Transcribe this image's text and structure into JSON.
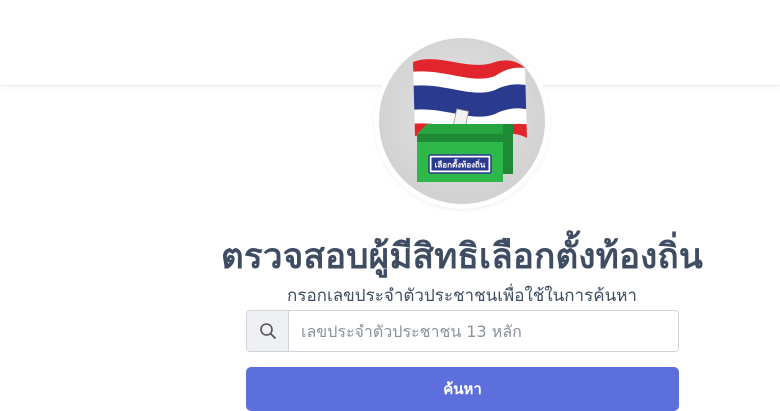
{
  "header": {},
  "logo": {
    "box_label": "เลือกตั้งท้องถิ่น",
    "colors": {
      "flag_red": "#e0262c",
      "flag_white": "#ffffff",
      "flag_blue": "#2a3a8f",
      "ballot_box_green": "#2fb84a",
      "ballot_box_dark": "#1f8a35",
      "circle_bg": "#d8d8d8"
    },
    "icon": "thai-flag-ballot-box-icon"
  },
  "main": {
    "title": "ตรวจสอบผู้มีสิทธิเลือกตั้งท้องถิ่น",
    "subtitle": "กรอกเลขประจำตัวประชาชนเพื่อใช้ในการค้นหา",
    "search": {
      "icon": "search-icon",
      "value": "",
      "placeholder": "เลขประจำตัวประชาชน 13 หลัก"
    },
    "search_button_label": "ค้นหา"
  },
  "colors": {
    "title_text": "#3f4d63",
    "button_bg": "#5c6fdc",
    "button_text": "#ffffff",
    "input_border": "#cfd4da",
    "addon_bg": "#eef0f3"
  }
}
